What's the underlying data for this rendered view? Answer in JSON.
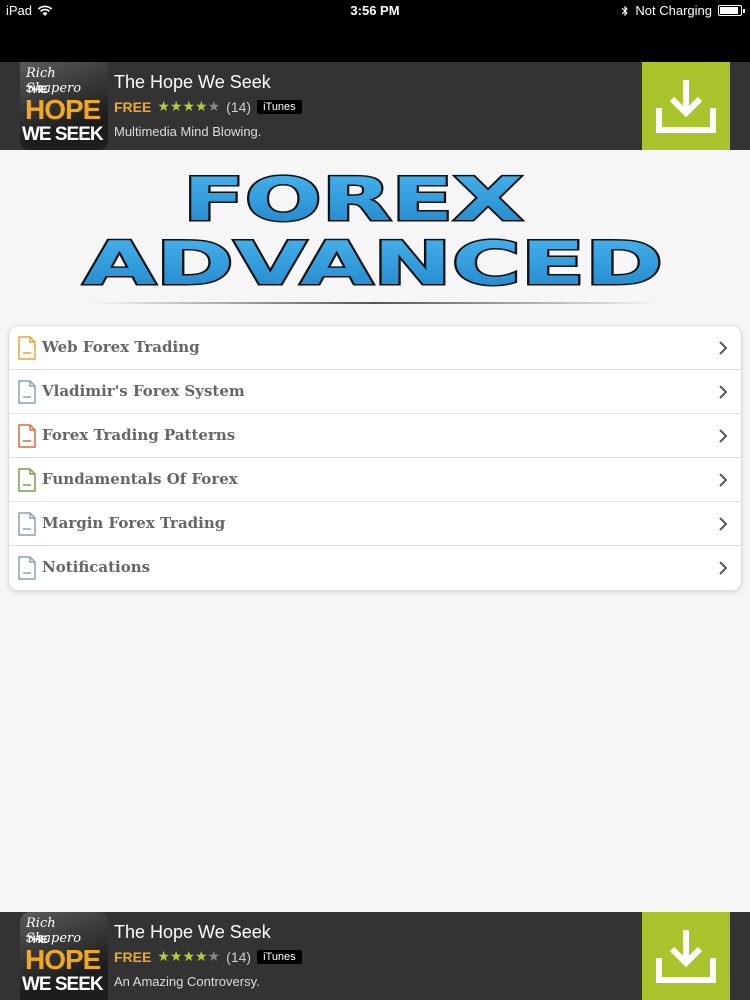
{
  "status_bar": {
    "device": "iPad",
    "time": "3:56 PM",
    "charging": "Not Charging"
  },
  "ad_top": {
    "thumb_line1": "Rich Shapero",
    "thumb_line2": "THE",
    "thumb_line3": "HOPE",
    "thumb_line4": "WE SEEK",
    "title": "The Hope We Seek",
    "price": "FREE",
    "rating_count": "(14)",
    "store": "iTunes",
    "subtitle": "Multimedia Mind Blowing.",
    "rating_stars": 4
  },
  "ad_bottom": {
    "thumb_line1": "Rich Shapero",
    "thumb_line2": "THE",
    "thumb_line3": "HOPE",
    "thumb_line4": "WE SEEK",
    "title": "The Hope We Seek",
    "price": "FREE",
    "rating_count": "(14)",
    "store": "iTunes",
    "subtitle": "An Amazing Controversy.",
    "rating_stars": 4
  },
  "logo": {
    "line1": "FOREX",
    "line2": "ADVANCED"
  },
  "menu": {
    "items": [
      {
        "label": "Web Forex Trading",
        "icon_color": "#e8a630"
      },
      {
        "label": "Vladimir's Forex System",
        "icon_color": "#8aa0b4"
      },
      {
        "label": "Forex Trading Patterns",
        "icon_color": "#e0663a"
      },
      {
        "label": "Fundamentals Of Forex",
        "icon_color": "#7aa050"
      },
      {
        "label": "Margin Forex Trading",
        "icon_color": "#8aa0b4"
      },
      {
        "label": "Notifications",
        "icon_color": "#8aa0b4"
      }
    ]
  },
  "colors": {
    "accent_green": "#a9c42d",
    "price_orange": "#f2a81d",
    "logo_blue": "#2b9fe0"
  }
}
